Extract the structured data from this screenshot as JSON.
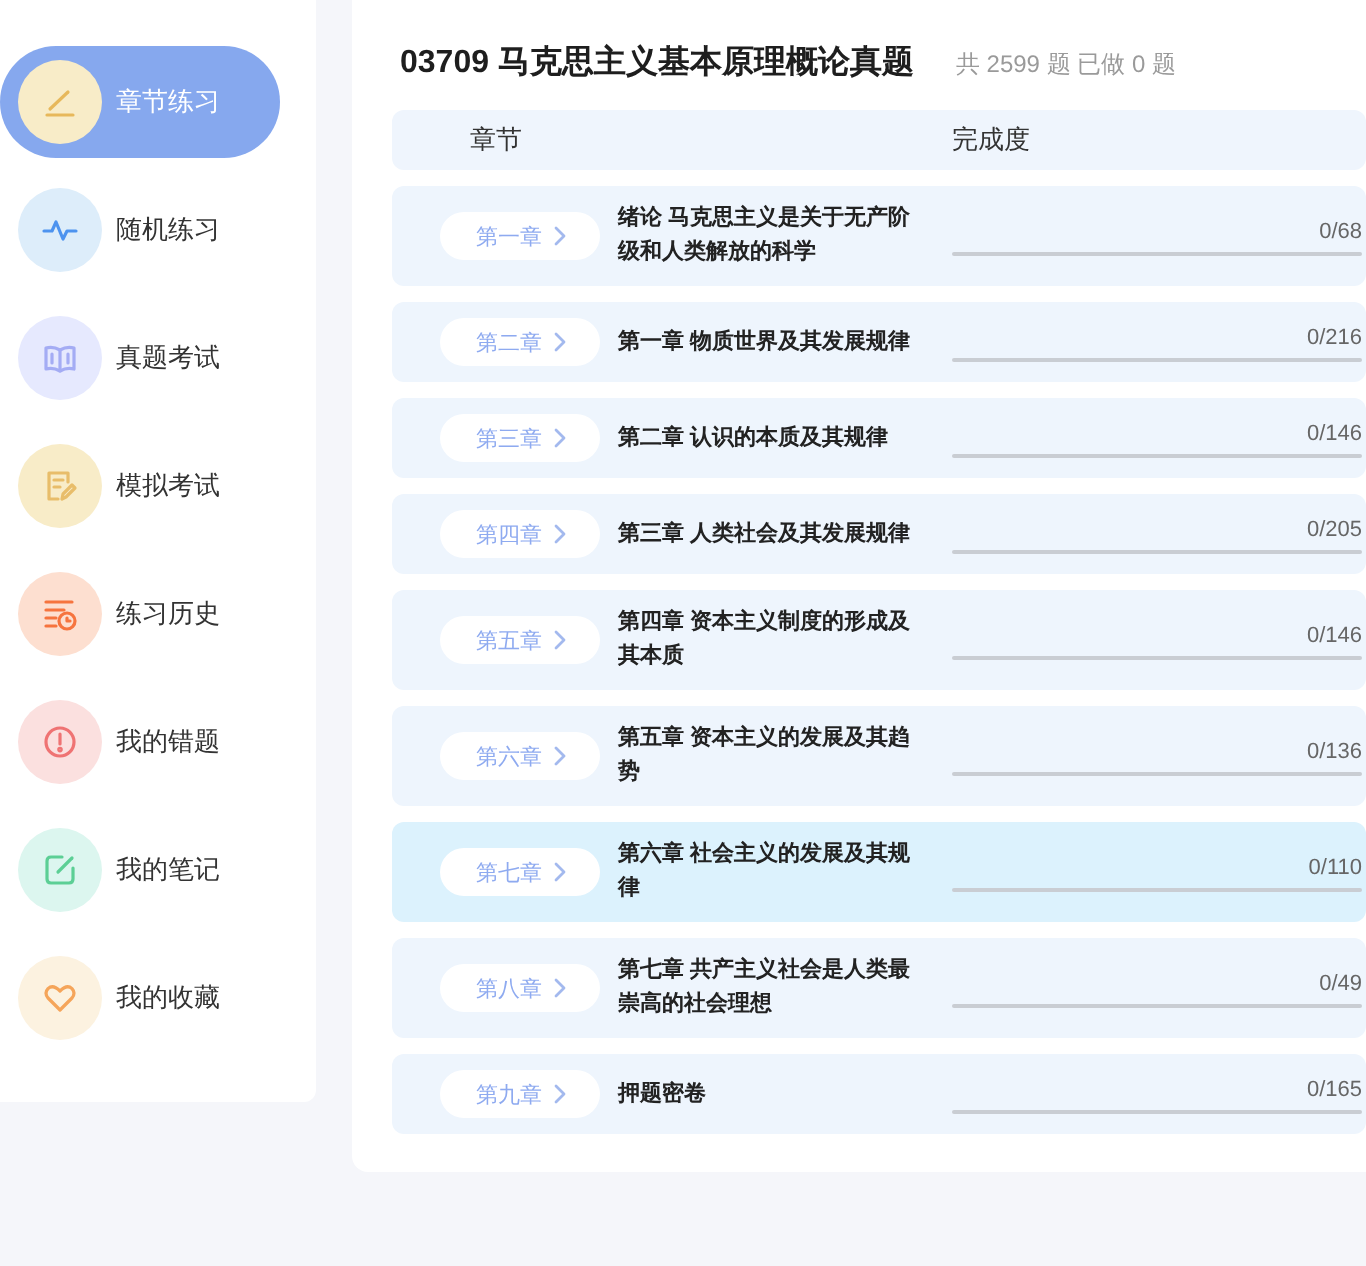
{
  "sidebar": {
    "items": [
      {
        "label": "章节练习",
        "selected": true
      },
      {
        "label": "随机练习",
        "selected": false
      },
      {
        "label": "真题考试",
        "selected": false
      },
      {
        "label": "模拟考试",
        "selected": false
      },
      {
        "label": "练习历史",
        "selected": false
      },
      {
        "label": "我的错题",
        "selected": false
      },
      {
        "label": "我的笔记",
        "selected": false
      },
      {
        "label": "我的收藏",
        "selected": false
      }
    ]
  },
  "header": {
    "title": "03709 马克思主义基本原理概论真题",
    "stats": "共 2599 题 已做 0 题"
  },
  "table": {
    "columns": [
      "章节",
      "完成度"
    ],
    "rows": [
      {
        "chapter": "第一章",
        "title": "绪论 马克思主义是关于无产阶级和人类解放的科学",
        "progress": "0/68",
        "highlighted": false
      },
      {
        "chapter": "第二章",
        "title": "第一章 物质世界及其发展规律",
        "progress": "0/216",
        "highlighted": false
      },
      {
        "chapter": "第三章",
        "title": "第二章 认识的本质及其规律",
        "progress": "0/146",
        "highlighted": false
      },
      {
        "chapter": "第四章",
        "title": "第三章 人类社会及其发展规律",
        "progress": "0/205",
        "highlighted": false
      },
      {
        "chapter": "第五章",
        "title": "第四章 资本主义制度的形成及其本质",
        "progress": "0/146",
        "highlighted": false
      },
      {
        "chapter": "第六章",
        "title": "第五章 资本主义的发展及其趋势",
        "progress": "0/136",
        "highlighted": false
      },
      {
        "chapter": "第七章",
        "title": "第六章 社会主义的发展及其规律",
        "progress": "0/110",
        "highlighted": true
      },
      {
        "chapter": "第八章",
        "title": "第七章 共产主义社会是人类最崇高的社会理想",
        "progress": "0/49",
        "highlighted": false
      },
      {
        "chapter": "第九章",
        "title": "押题密卷",
        "progress": "0/165",
        "highlighted": false
      }
    ]
  }
}
